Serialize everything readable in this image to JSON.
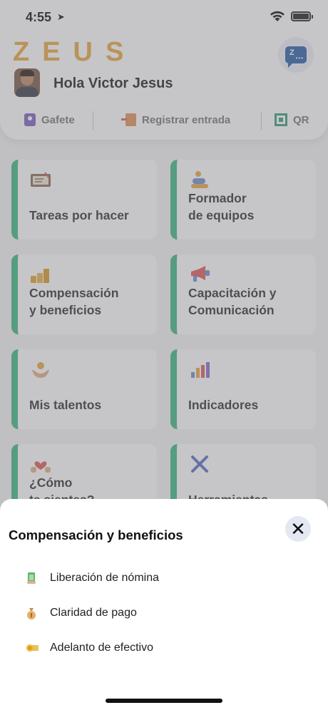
{
  "status_bar": {
    "time": "4:55",
    "location_icon": "location-arrow-icon",
    "wifi_icon": "wifi-icon",
    "battery_icon": "battery-icon"
  },
  "header": {
    "brand": "ZEUS",
    "chat_icon": "chat-bubble-icon",
    "chat_icon_letter": "Z",
    "chat_icon_dots": "•••",
    "greeting": "Hola Victor Jesus",
    "quick_actions": [
      {
        "label": "Gafete",
        "icon": "badge-icon"
      },
      {
        "label": "Registrar entrada",
        "icon": "door-entry-icon"
      },
      {
        "label": "QR",
        "icon": "qr-code-icon"
      }
    ]
  },
  "tiles": [
    {
      "label": "Tareas por hacer",
      "icon": "tasks-board-icon"
    },
    {
      "label": "Formador\nde equipos",
      "icon": "team-builder-icon"
    },
    {
      "label": "Compensación\ny beneficios",
      "icon": "coins-stack-icon"
    },
    {
      "label": "Capacitación y\nComunicación",
      "icon": "megaphone-icon"
    },
    {
      "label": "Mis talentos",
      "icon": "talent-hands-icon"
    },
    {
      "label": "Indicadores",
      "icon": "bar-chart-icon"
    },
    {
      "label": "¿Cómo\nte sientes?",
      "icon": "heart-hands-icon"
    },
    {
      "label": "Herramientas",
      "icon": "tools-icon"
    }
  ],
  "sheet": {
    "title": "Compensación y beneficios",
    "close_icon": "close-icon",
    "options": [
      {
        "label": "Liberación de nómina",
        "icon": "payroll-release-icon"
      },
      {
        "label": "Claridad de pago",
        "icon": "money-bag-icon"
      },
      {
        "label": "Adelanto de efectivo",
        "icon": "cash-advance-icon"
      }
    ]
  },
  "colors": {
    "accent": "#3fb983",
    "brand": "#e8a740",
    "chat": "#2b5fa6",
    "close_bg": "#e3e8f2"
  }
}
